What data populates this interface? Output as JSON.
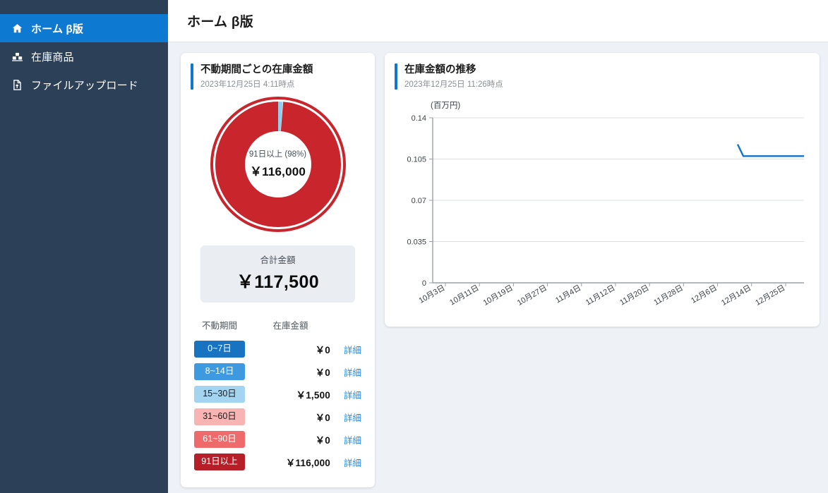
{
  "sidebar": {
    "items": [
      {
        "label": "ホーム β版",
        "icon": "home-icon",
        "active": true
      },
      {
        "label": "在庫商品",
        "icon": "warehouse-icon",
        "active": false
      },
      {
        "label": "ファイルアップロード",
        "icon": "file-upload-icon",
        "active": false
      }
    ]
  },
  "header": {
    "title": "ホーム β版"
  },
  "colors": {
    "sidebar_bg": "#2c4058",
    "sidebar_active": "#0d79d1",
    "accent": "#1177ce",
    "link": "#2589e8",
    "donut_red": "#c8252c",
    "donut_blue": "#93cdee",
    "line": "#1573c4",
    "page_bg": "#eef1f5"
  },
  "inventory_card": {
    "title": "不動期間ごとの在庫金額",
    "subtitle": "2023年12月25日 4:11時点",
    "donut_center_label": "91日以上 (98%)",
    "donut_center_value": "￥116,000",
    "total_label": "合計金額",
    "total_value": "￥117,500",
    "table": {
      "columns": [
        "不動期間",
        "在庫金額"
      ],
      "detail_label": "詳細",
      "rows": [
        {
          "period": "0~7日",
          "amount": "￥0",
          "color": "#1874c0",
          "text_color": "#ffffff",
          "percent": 0
        },
        {
          "period": "8~14日",
          "amount": "￥0",
          "color": "#3d9ae0",
          "text_color": "#ffffff",
          "percent": 0
        },
        {
          "period": "15~30日",
          "amount": "￥1,500",
          "color": "#a3d4f0",
          "text_color": "#1b1b1b",
          "percent": 1.3
        },
        {
          "period": "31~60日",
          "amount": "￥0",
          "color": "#f8b3b3",
          "text_color": "#1b1b1b",
          "percent": 0
        },
        {
          "period": "61~90日",
          "amount": "￥0",
          "color": "#ef6b6b",
          "text_color": "#ffffff",
          "percent": 0
        },
        {
          "period": "91日以上",
          "amount": "￥116,000",
          "color": "#b61f27",
          "text_color": "#ffffff",
          "percent": 98.7
        }
      ]
    }
  },
  "trend_card": {
    "title": "在庫金額の推移",
    "subtitle": "2023年12月25日 11:26時点"
  },
  "chart_data": {
    "type": "line",
    "title": "在庫金額の推移",
    "ylabel": "(百万円)",
    "xlabel": "",
    "ylim": [
      0,
      0.14
    ],
    "yticks": [
      "0",
      "0.035",
      "0.07",
      "0.105",
      "0.14"
    ],
    "ytick_values": [
      0,
      0.035,
      0.07,
      0.105,
      0.14
    ],
    "grid": true,
    "legend": "none",
    "xticks": [
      "10月3日",
      "10月11日",
      "10月19日",
      "10月27日",
      "11月4日",
      "11月12日",
      "11月20日",
      "11月28日",
      "12月6日",
      "12月14日",
      "12月25日"
    ],
    "series": [
      {
        "name": "在庫金額",
        "x": [
          "12月19日",
          "12月20日",
          "12月25日"
        ],
        "values": [
          0.1175,
          0.1075,
          0.1075
        ]
      }
    ]
  }
}
